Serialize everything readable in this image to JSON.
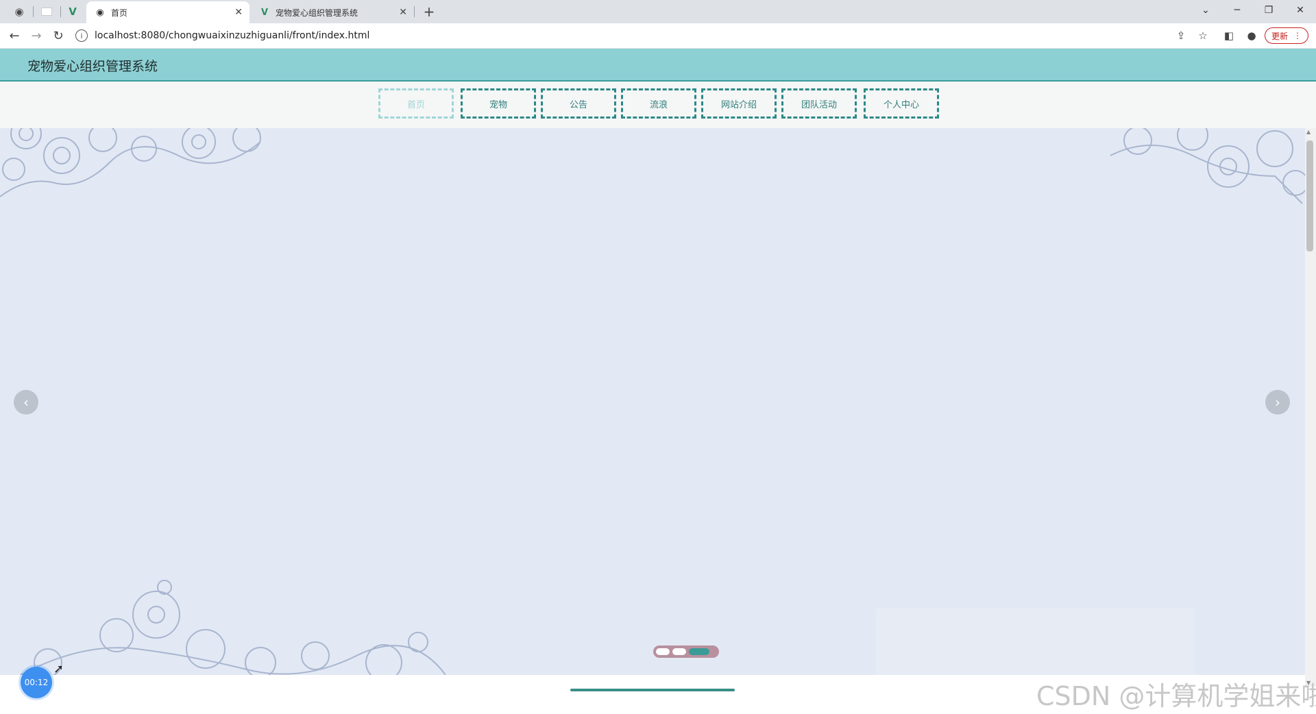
{
  "browser": {
    "tabs": [
      {
        "title": "首页",
        "active": true
      },
      {
        "title": "宠物爱心组织管理系统",
        "active": false
      }
    ],
    "url": "localhost:8080/chongwuaixinzuzhiguanli/front/index.html",
    "update_label": "更新"
  },
  "site": {
    "title": "宠物爱心组织管理系统"
  },
  "nav": {
    "items": [
      {
        "label": "首页",
        "active": true
      },
      {
        "label": "宠物",
        "active": false
      },
      {
        "label": "公告",
        "active": false
      },
      {
        "label": "流浪",
        "active": false
      },
      {
        "label": "网站介绍",
        "active": false
      },
      {
        "label": "团队活动",
        "active": false
      },
      {
        "label": "个人中心",
        "active": false
      }
    ]
  },
  "carousel": {
    "slide_count": 3,
    "active_index": 3
  },
  "overlay": {
    "timer": "00:12",
    "watermark": "CSDN @计算机学姐来啦"
  },
  "colors": {
    "header_bg": "#8dd0d4",
    "accent": "#2c8a86",
    "carousel_bg": "#e2e9f4"
  }
}
